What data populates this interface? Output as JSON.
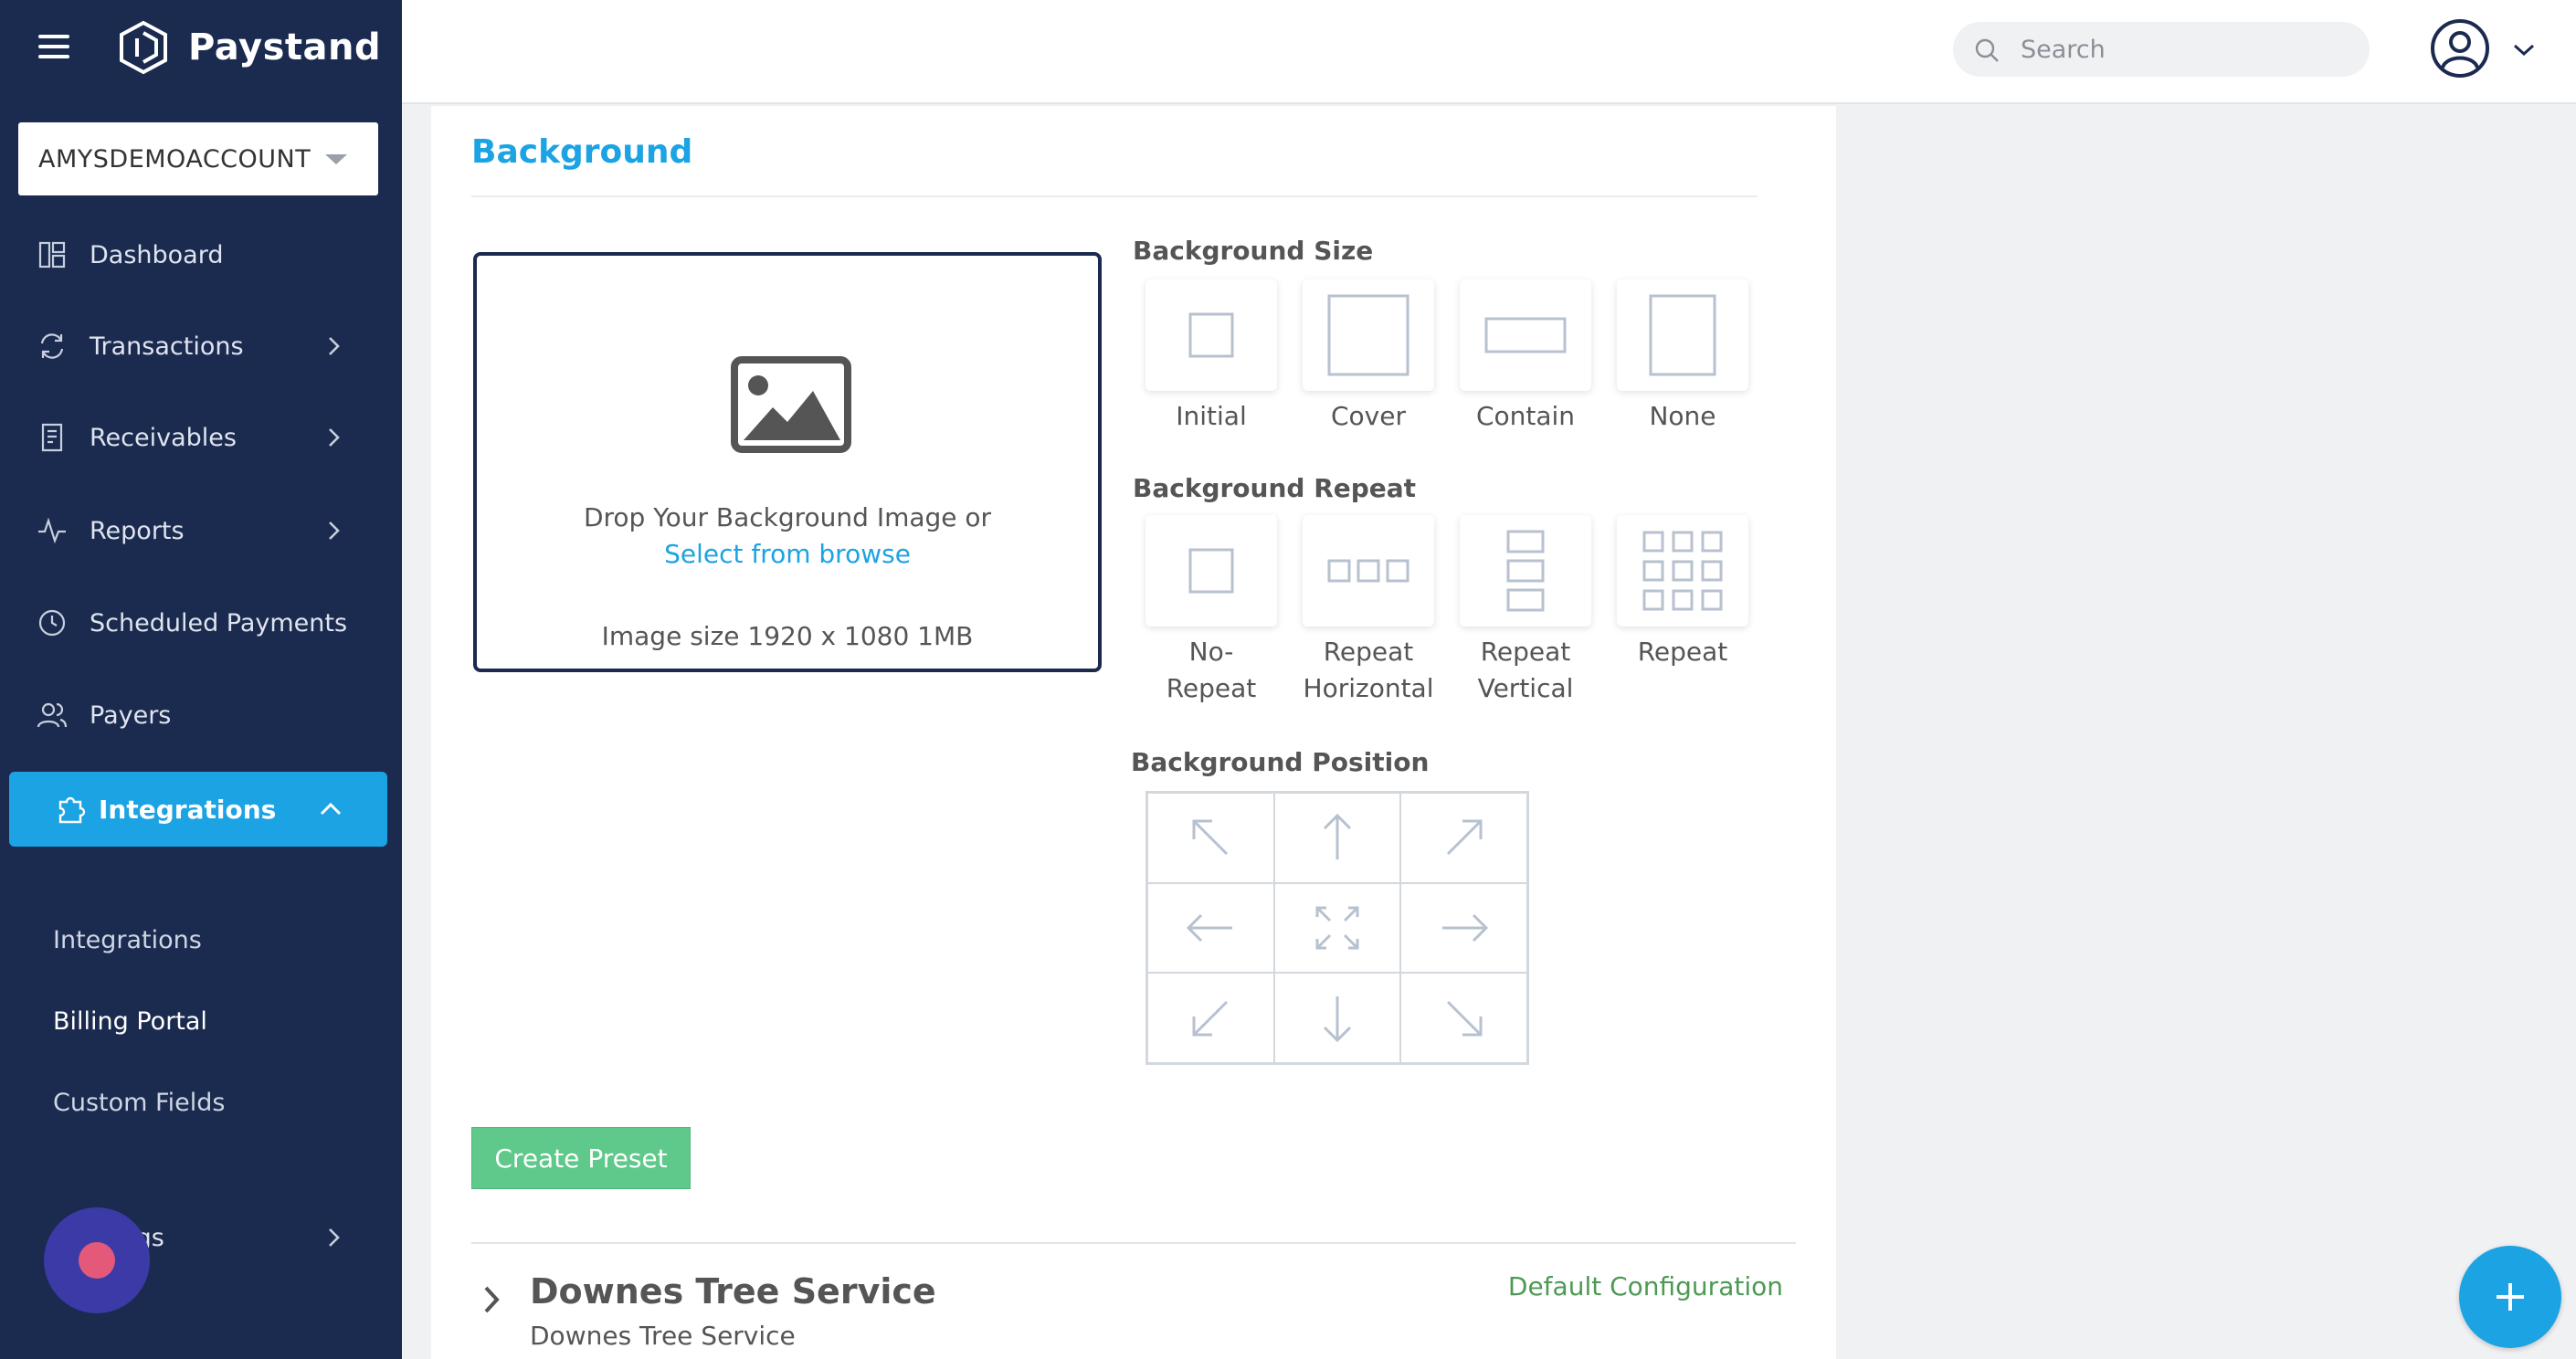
{
  "app": {
    "brand": "Paystand"
  },
  "sidebar": {
    "account": "AMYSDEMOACCOUNT",
    "items": [
      {
        "label": "Dashboard",
        "icon": "dashboard-icon"
      },
      {
        "label": "Transactions",
        "icon": "refresh-icon"
      },
      {
        "label": "Receivables",
        "icon": "receipt-icon"
      },
      {
        "label": "Reports",
        "icon": "activity-icon"
      },
      {
        "label": "Scheduled Payments",
        "icon": "clock-icon"
      },
      {
        "label": "Payers",
        "icon": "users-icon"
      }
    ],
    "active": {
      "label": "Integrations",
      "icon": "puzzle-icon"
    },
    "subitems": [
      "Integrations",
      "Billing Portal",
      "Custom Fields"
    ],
    "settings_partial": "ings"
  },
  "header": {
    "search_placeholder": "Search"
  },
  "background": {
    "title": "Background",
    "drop_text": "Drop Your Background Image or",
    "browse_link": "Select from browse",
    "size_hint": "Image size 1920 x 1080 1MB",
    "size_label": "Background Size",
    "size_options": [
      "Initial",
      "Cover",
      "Contain",
      "None"
    ],
    "repeat_label": "Background Repeat",
    "repeat_options": [
      {
        "line1": "No-",
        "line2": "Repeat"
      },
      {
        "line1": "Repeat",
        "line2": "Horizontal"
      },
      {
        "line1": "Repeat",
        "line2": "Vertical"
      },
      {
        "line1": "Repeat",
        "line2": ""
      }
    ],
    "position_label": "Background Position",
    "create_button": "Create Preset"
  },
  "config": {
    "title": "Downes Tree Service",
    "subtitle": "Downes Tree Service",
    "default_label": "Default Configuration"
  },
  "colors": {
    "sidebar": "#1b2a4f",
    "accent": "#1ba3e3",
    "success": "#5ec98a"
  }
}
